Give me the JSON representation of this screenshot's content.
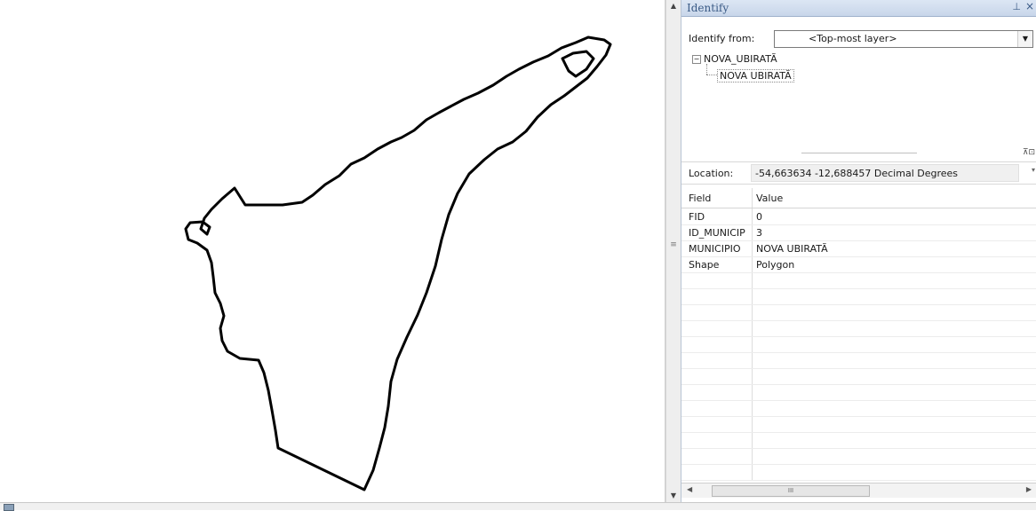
{
  "panel": {
    "title": "Identify",
    "identify_from_label": "Identify from:",
    "identify_from_value": "<Top-most layer>",
    "tree": {
      "layer": "NOVA_UBIRATÃ",
      "feature": "NOVA UBIRATÃ"
    },
    "location_label": "Location:",
    "location_value": "-54,663634  -12,688457 Decimal Degrees",
    "columns": {
      "field": "Field",
      "value": "Value"
    },
    "rows": [
      {
        "field": "FID",
        "value": "0"
      },
      {
        "field": "ID_MUNICIP",
        "value": "3"
      },
      {
        "field": "MUNICIPIO",
        "value": "NOVA UBIRATÃ"
      },
      {
        "field": "Shape",
        "value": "Polygon"
      }
    ],
    "scroll_grip": "III"
  },
  "map": {
    "feature_outline_color": "#000000"
  },
  "colors": {
    "panel_title": "#3b5b86",
    "titlebar_bg": "#c8d6ea"
  }
}
